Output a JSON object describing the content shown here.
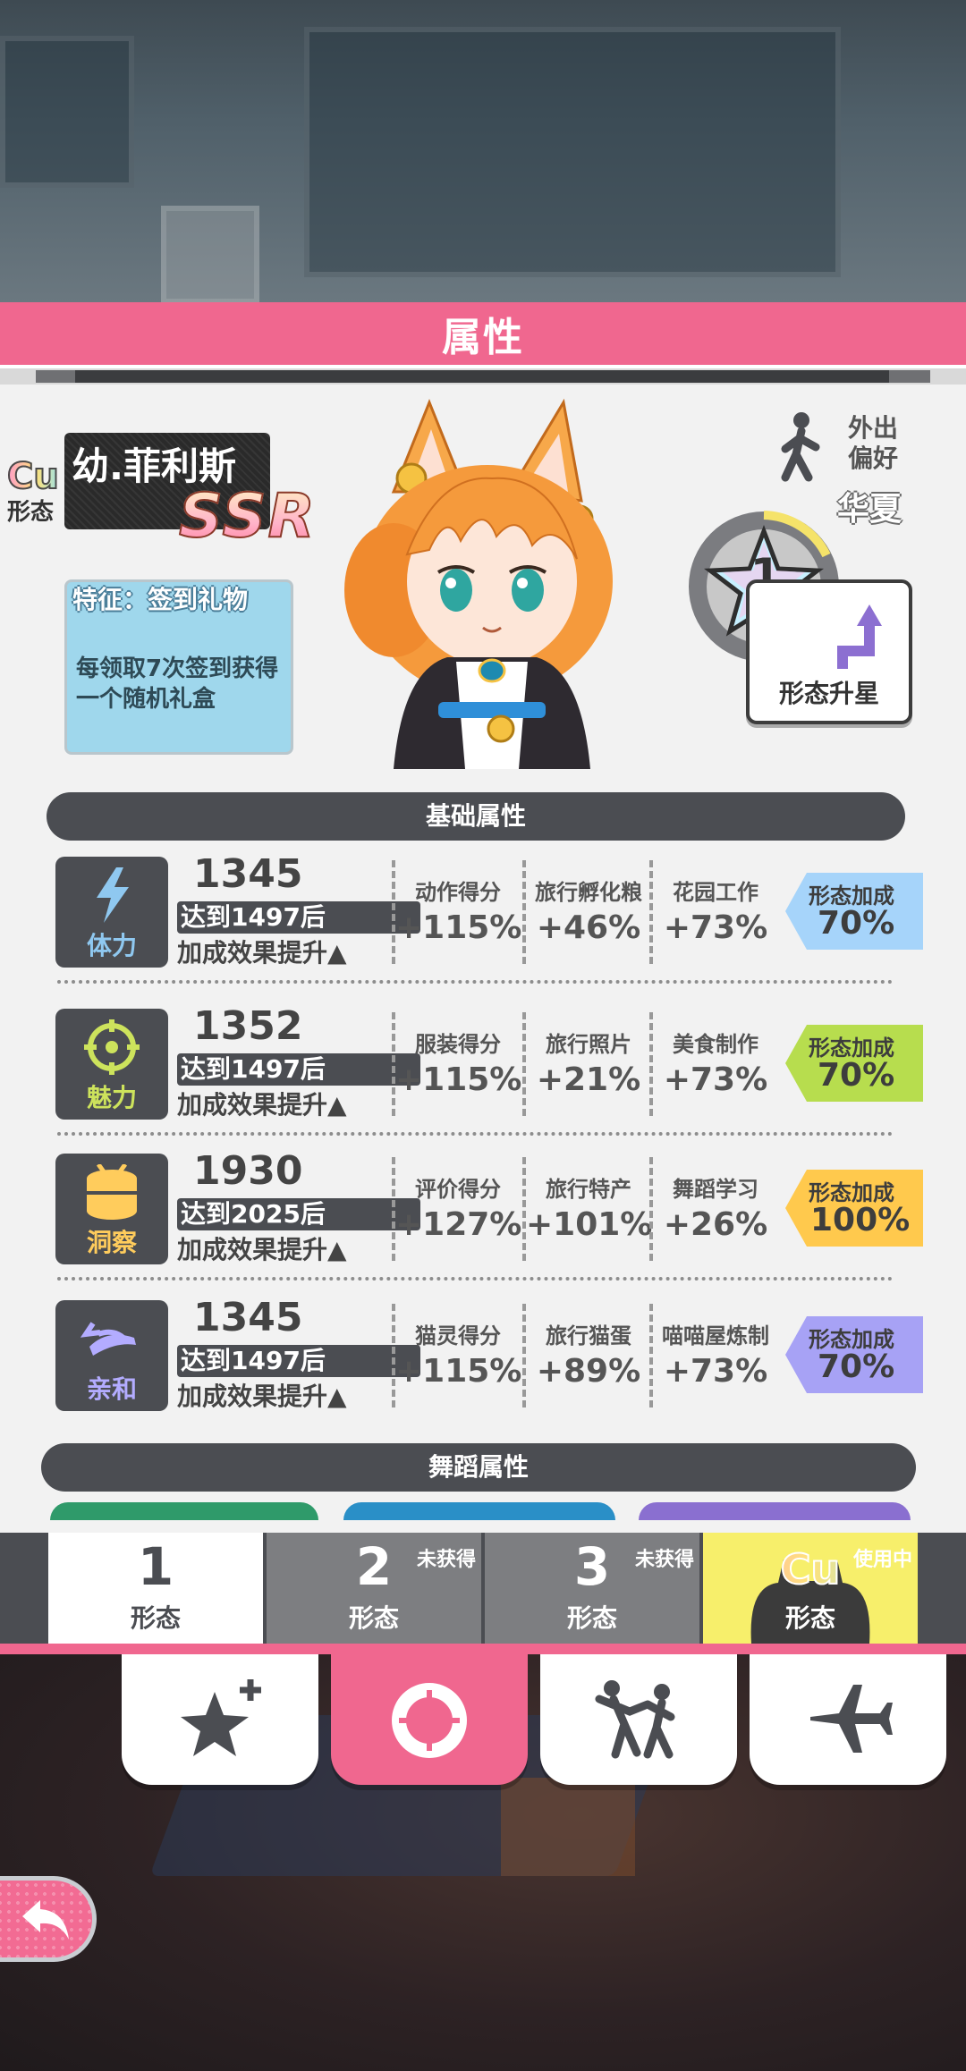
{
  "header": {
    "title": "属性"
  },
  "character": {
    "cu_label": "Cu",
    "form_label": "形态",
    "name": "幼.菲利斯",
    "rarity": "SSR",
    "feature_title": "特征：签到礼物",
    "feature_desc": "每领取7次签到获得一个随机礼盒"
  },
  "preference": {
    "label_line1": "外出",
    "label_line2": "偏好",
    "region": "华夏"
  },
  "star": {
    "level": "1",
    "upgrade_label": "形态升星"
  },
  "sections": {
    "basic": "基础属性",
    "dance": "舞蹈属性"
  },
  "stats": [
    {
      "name": "体力",
      "value": "1345",
      "target": "达到1497后",
      "boost": "加成效果提升▲",
      "subs": [
        {
          "label": "动作得分",
          "value": "+115%"
        },
        {
          "label": "旅行孵化粮",
          "value": "+46%"
        },
        {
          "label": "花园工作",
          "value": "+73%"
        }
      ],
      "bonus_label": "形态加成",
      "bonus_value": "70%",
      "bonus_color": "#a6d4fa",
      "name_color": "#8fc8f0"
    },
    {
      "name": "魅力",
      "value": "1352",
      "target": "达到1497后",
      "boost": "加成效果提升▲",
      "subs": [
        {
          "label": "服装得分",
          "value": "+115%"
        },
        {
          "label": "旅行照片",
          "value": "+21%"
        },
        {
          "label": "美食制作",
          "value": "+73%"
        }
      ],
      "bonus_label": "形态加成",
      "bonus_value": "70%",
      "bonus_color": "#b7dd4e",
      "name_color": "#cde35c"
    },
    {
      "name": "洞察",
      "value": "1930",
      "target": "达到2025后",
      "boost": "加成效果提升▲",
      "subs": [
        {
          "label": "评价得分",
          "value": "+127%"
        },
        {
          "label": "旅行特产",
          "value": "+101%"
        },
        {
          "label": "舞蹈学习",
          "value": "+26%"
        }
      ],
      "bonus_label": "形态加成",
      "bonus_value": "100%",
      "bonus_color": "#ffc94d",
      "name_color": "#ffcc5c"
    },
    {
      "name": "亲和",
      "value": "1345",
      "target": "达到1497后",
      "boost": "加成效果提升▲",
      "subs": [
        {
          "label": "猫灵得分",
          "value": "+115%"
        },
        {
          "label": "旅行猫蛋",
          "value": "+89%"
        },
        {
          "label": "喵喵屋炼制",
          "value": "+73%"
        }
      ],
      "bonus_label": "形态加成",
      "bonus_value": "70%",
      "bonus_color": "#a7a2f5",
      "name_color": "#b3acff"
    }
  ],
  "form_tabs": [
    {
      "num": "1",
      "label": "形态",
      "tag": ""
    },
    {
      "num": "2",
      "label": "形态",
      "tag": "未获得"
    },
    {
      "num": "3",
      "label": "形态",
      "tag": "未获得"
    },
    {
      "num": "Cu",
      "label": "形态",
      "tag": "使用中"
    }
  ],
  "nav": [
    {
      "icon": "star-plus-icon"
    },
    {
      "icon": "ring-icon"
    },
    {
      "icon": "dance-icon"
    },
    {
      "icon": "airplane-icon"
    }
  ]
}
